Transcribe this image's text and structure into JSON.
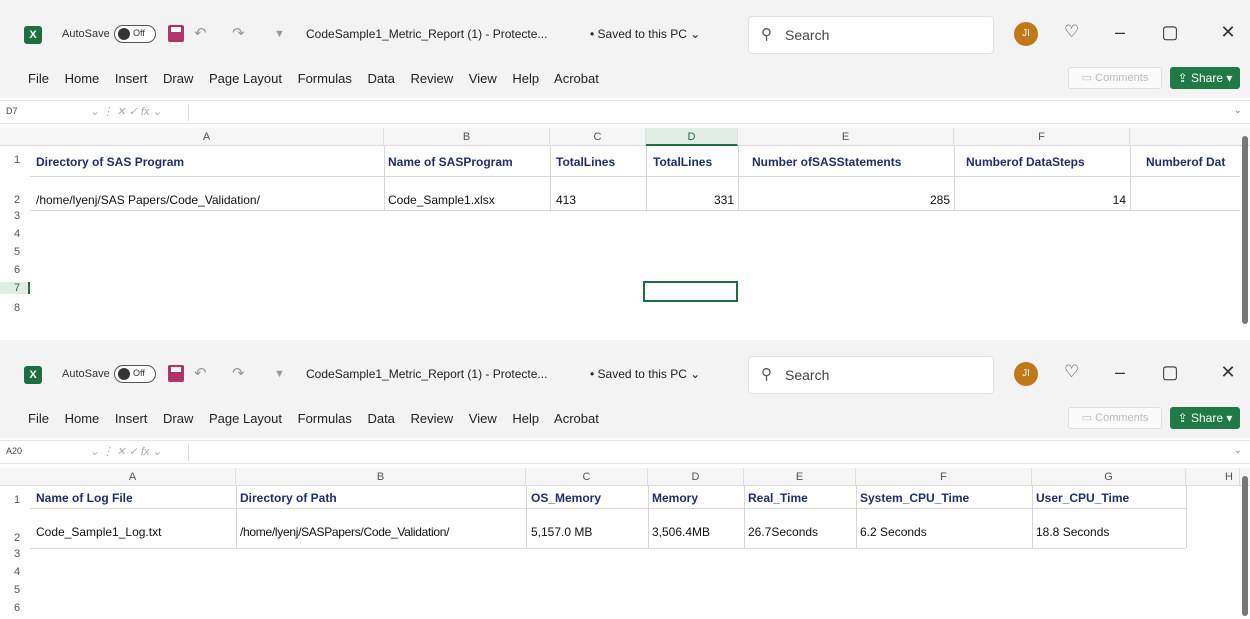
{
  "window1": {
    "autosave_label": "AutoSave",
    "autosave_state": "Off",
    "doc_title": "CodeSample1_Metric_Report (1)  -  Protecte...",
    "saved_status": "• Saved to this PC ⌄",
    "search_placeholder": "Search",
    "menu": [
      "File",
      "Home",
      "Insert",
      "Draw",
      "Page Layout",
      "Formulas",
      "Data",
      "Review",
      "View",
      "Help",
      "Acrobat"
    ],
    "comments_label": "Comments",
    "share_label": "Share",
    "name_box": "D7",
    "columns": [
      "A",
      "B",
      "C",
      "D",
      "E",
      "F"
    ],
    "selected_column": "D",
    "rows": [
      "1",
      "2",
      "3",
      "4",
      "5",
      "6",
      "7",
      "8"
    ],
    "selected_row": "7",
    "headers": [
      "Directory of SAS Program",
      "Name of SASProgram",
      "TotalLines",
      "TotalLines",
      "Number ofSASStatements",
      "Numberof DataSteps",
      "Numberof Dat"
    ],
    "values": [
      "/home/lyenj/SAS Papers/Code_Validation/",
      "Code_Sample1.xlsx",
      "413",
      "331",
      "285",
      "14",
      ""
    ]
  },
  "window2": {
    "autosave_label": "AutoSave",
    "autosave_state": "Off",
    "doc_title": "CodeSample1_Metric_Report (1)  -  Protecte...",
    "saved_status": "• Saved to this PC ⌄",
    "search_placeholder": "Search",
    "menu": [
      "File",
      "Home",
      "Insert",
      "Draw",
      "Page Layout",
      "Formulas",
      "Data",
      "Review",
      "View",
      "Help",
      "Acrobat"
    ],
    "comments_label": "Comments",
    "share_label": "Share",
    "name_box": "A20",
    "columns": [
      "A",
      "B",
      "C",
      "D",
      "E",
      "F",
      "G",
      "H"
    ],
    "rows": [
      "1",
      "2",
      "3",
      "4",
      "5",
      "6"
    ],
    "headers": [
      "Name of Log File",
      "Directory of Path",
      "OS_Memory",
      "Memory",
      "Real_Time",
      "System_CPU_Time",
      "User_CPU_Time"
    ],
    "values": [
      "Code_Sample1_Log.txt",
      "/home/lyenj/SASPapers/Code_Validation/",
      "5,157.0 MB",
      "3,506.4MB",
      "26.7Seconds",
      "6.2 Seconds",
      "18.8 Seconds"
    ]
  },
  "colors": {
    "excel_green": "#1d6f42",
    "header_text": "#1f2d6e",
    "chrome": "#f3f3f3"
  },
  "icons": [
    "excel-logo-icon",
    "save-icon",
    "undo-icon",
    "redo-icon",
    "customize-icon",
    "search-icon",
    "lightbulb-icon",
    "minimize-icon",
    "restore-icon",
    "close-icon",
    "comment-icon",
    "share-icon",
    "fx-icon"
  ]
}
